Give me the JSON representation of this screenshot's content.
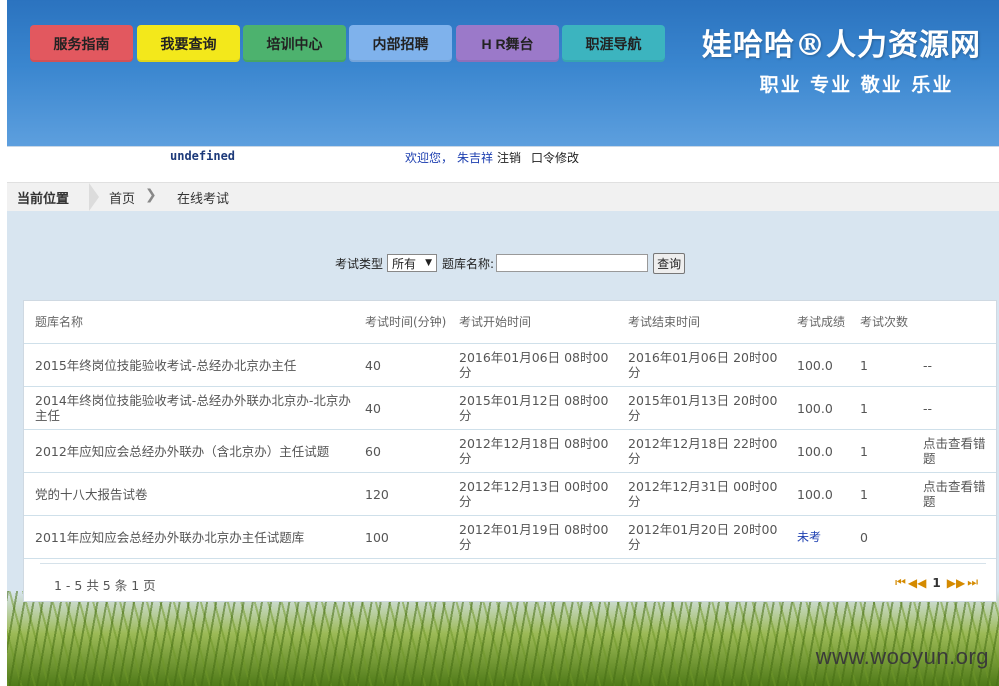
{
  "nav": [
    {
      "label": "服务指南",
      "color": "#e2585f"
    },
    {
      "label": "我要查询",
      "color": "#f3e81b"
    },
    {
      "label": "培训中心",
      "color": "#4db26e"
    },
    {
      "label": "内部招聘",
      "color": "#7fb2ec"
    },
    {
      "label": "H R舞台",
      "color": "#9b79c9"
    },
    {
      "label": "职涯导航",
      "color": "#3cb4bf"
    }
  ],
  "brand": {
    "title": "娃哈哈®人力资源网",
    "subtitle": "职业 专业 敬业 乐业"
  },
  "userbar": {
    "undefined_text": "undefined",
    "welcome": "欢迎您，",
    "username": "朱吉祥",
    "logout": "注销",
    "password_change": "口令修改"
  },
  "breadcrumb": {
    "label": "当前位置",
    "home": "首页",
    "current": "在线考试"
  },
  "filter": {
    "type_label": "考试类型",
    "type_value": "所有",
    "name_label": "题库名称:",
    "name_value": "",
    "query_button": "查询"
  },
  "table": {
    "headers": [
      "题库名称",
      "考试时间(分钟)",
      "考试开始时间",
      "考试结束时间",
      "考试成绩",
      "考试次数",
      ""
    ],
    "rows": [
      [
        "2015年终岗位技能验收考试-总经办北京办主任",
        "40",
        "2016年01月06日 08时00分",
        "2016年01月06日 20时00分",
        "100.0",
        "1",
        "--"
      ],
      [
        "2014年终岗位技能验收考试-总经办外联办北京办-北京办主任",
        "40",
        "2015年01月12日 08时00分",
        "2015年01月13日 20时00分",
        "100.0",
        "1",
        "--"
      ],
      [
        "2012年应知应会总经办外联办（含北京办）主任试题",
        "60",
        "2012年12月18日 08时00分",
        "2012年12月18日 22时00分",
        "100.0",
        "1",
        "点击查看错题"
      ],
      [
        "党的十八大报告试卷",
        "120",
        "2012年12月13日 00时00分",
        "2012年12月31日 00时00分",
        "100.0",
        "1",
        "点击查看错题"
      ],
      [
        "2011年应知应会总经办外联办北京办主任试题库",
        "100",
        "2012年01月19日 08时00分",
        "2012年01月20日 20时00分",
        "未考",
        "0",
        ""
      ]
    ]
  },
  "pager": {
    "info": "1 - 5 共 5 条 1 页",
    "current_page": "1",
    "first": "⏮",
    "prev": "◀◀",
    "next": "▶▶",
    "last": "⏭"
  },
  "watermark": "www.wooyun.org"
}
